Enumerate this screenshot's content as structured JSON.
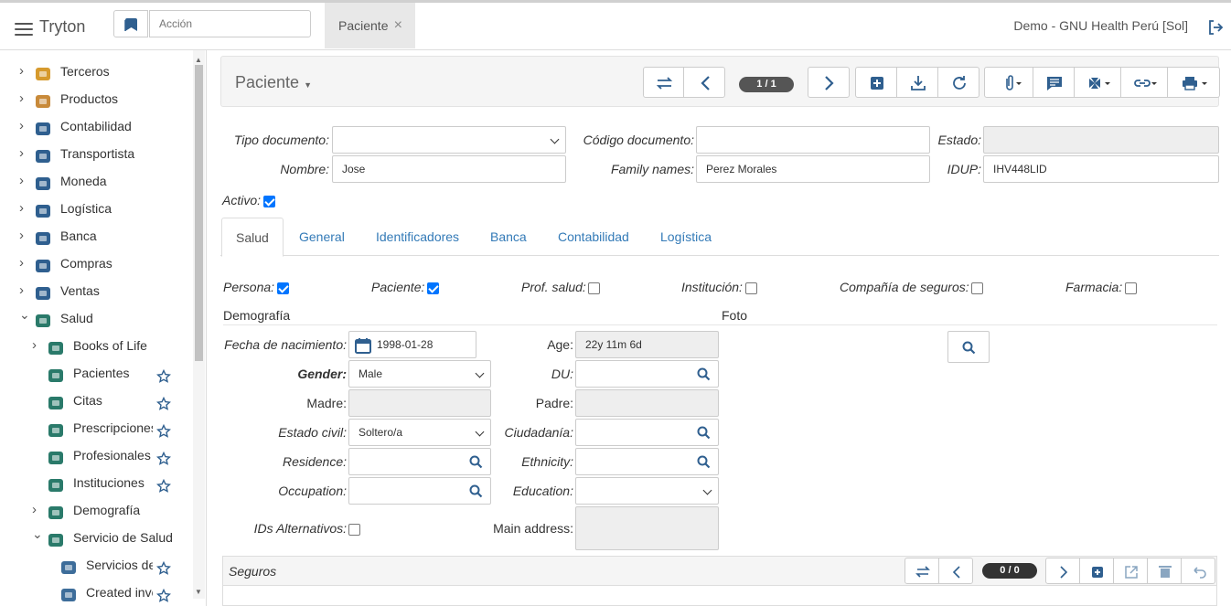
{
  "app": {
    "brand": "Tryton",
    "action_placeholder": "Acción",
    "open_tab": "Paciente",
    "user_info": "Demo - GNU Health Perú [Sol]"
  },
  "sidebar": {
    "items": [
      {
        "label": "Terceros",
        "icon": "people-icon"
      },
      {
        "label": "Productos",
        "icon": "package-icon"
      },
      {
        "label": "Contabilidad",
        "icon": "calculator-icon"
      },
      {
        "label": "Transportista",
        "icon": "truck-icon"
      },
      {
        "label": "Moneda",
        "icon": "currency-icon"
      },
      {
        "label": "Logística",
        "icon": "warehouse-icon"
      },
      {
        "label": "Banca",
        "icon": "bank-icon"
      },
      {
        "label": "Compras",
        "icon": "cart-icon"
      },
      {
        "label": "Ventas",
        "icon": "store-icon"
      },
      {
        "label": "Salud",
        "icon": "health-icon"
      },
      {
        "label": "Books of Life",
        "icon": "book-icon"
      },
      {
        "label": "Pacientes",
        "icon": "patient-icon"
      },
      {
        "label": "Citas",
        "icon": "clock-icon"
      },
      {
        "label": "Prescripciones",
        "icon": "rx-icon"
      },
      {
        "label": "Profesionales",
        "icon": "doctor-icon"
      },
      {
        "label": "Instituciones",
        "icon": "building-icon"
      },
      {
        "label": "Demografía",
        "icon": "globe-icon"
      },
      {
        "label": "Servicio de Salud",
        "icon": "medkit-icon"
      },
      {
        "label": "Servicios de Salud",
        "icon": "document-icon"
      },
      {
        "label": "Created invoices",
        "icon": "document-icon"
      }
    ]
  },
  "form": {
    "title": "Paciente",
    "record_counter": "1 / 1",
    "labels": {
      "tipo_documento": "Tipo documento:",
      "codigo_documento": "Código documento:",
      "estado": "Estado:",
      "nombre": "Nombre:",
      "family_names": "Family names:",
      "idup": "IDUP:",
      "activo": "Activo:"
    },
    "values": {
      "tipo_documento": "",
      "codigo_documento": "",
      "estado": "",
      "nombre": "Jose",
      "family_names": "Perez Morales",
      "idup": "IHV448LID",
      "activo": true
    },
    "tabs": [
      "Salud",
      "General",
      "Identificadores",
      "Banca",
      "Contabilidad",
      "Logística"
    ],
    "active_tab": "Salud",
    "flags": [
      {
        "label": "Persona:",
        "checked": true
      },
      {
        "label": "Paciente:",
        "checked": true
      },
      {
        "label": "Prof. salud:",
        "checked": false
      },
      {
        "label": "Institución:",
        "checked": false
      },
      {
        "label": "Compañía de seguros:",
        "checked": false
      },
      {
        "label": "Farmacia:",
        "checked": false
      }
    ],
    "sections": {
      "demografia": "Demografía",
      "foto": "Foto"
    },
    "demo": {
      "fecha_nacimiento_label": "Fecha de nacimiento:",
      "fecha_nacimiento": "1998-01-28",
      "age_label": "Age:",
      "age": "22y 11m 6d",
      "gender_label": "Gender:",
      "gender": "Male",
      "du_label": "DU:",
      "du": "",
      "madre_label": "Madre:",
      "madre": "",
      "padre_label": "Padre:",
      "padre": "",
      "estado_civil_label": "Estado civil:",
      "estado_civil": "Soltero/a",
      "ciudadania_label": "Ciudadanía:",
      "ciudadania": "",
      "residence_label": "Residence:",
      "residence": "",
      "ethnicity_label": "Ethnicity:",
      "ethnicity": "",
      "occupation_label": "Occupation:",
      "occupation": "",
      "education_label": "Education:",
      "education": "",
      "ids_alternativos_label": "IDs Alternativos:",
      "ids_alternativos": false,
      "main_address_label": "Main address:",
      "main_address": ""
    },
    "seguros": {
      "title": "Seguros",
      "counter": "0 / 0"
    }
  }
}
